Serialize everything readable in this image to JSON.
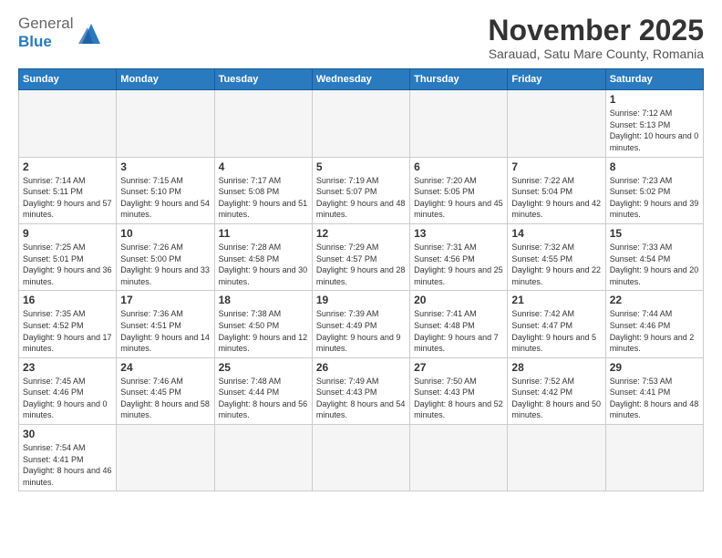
{
  "logo": {
    "text_general": "General",
    "text_blue": "Blue"
  },
  "title": "November 2025",
  "subtitle": "Sarauad, Satu Mare County, Romania",
  "headers": [
    "Sunday",
    "Monday",
    "Tuesday",
    "Wednesday",
    "Thursday",
    "Friday",
    "Saturday"
  ],
  "weeks": [
    [
      {
        "day": "",
        "empty": true
      },
      {
        "day": "",
        "empty": true
      },
      {
        "day": "",
        "empty": true
      },
      {
        "day": "",
        "empty": true
      },
      {
        "day": "",
        "empty": true
      },
      {
        "day": "",
        "empty": true
      },
      {
        "day": "1",
        "sunrise": "7:12 AM",
        "sunset": "5:13 PM",
        "daylight": "10 hours and 0 minutes."
      }
    ],
    [
      {
        "day": "2",
        "sunrise": "7:14 AM",
        "sunset": "5:11 PM",
        "daylight": "9 hours and 57 minutes."
      },
      {
        "day": "3",
        "sunrise": "7:15 AM",
        "sunset": "5:10 PM",
        "daylight": "9 hours and 54 minutes."
      },
      {
        "day": "4",
        "sunrise": "7:17 AM",
        "sunset": "5:08 PM",
        "daylight": "9 hours and 51 minutes."
      },
      {
        "day": "5",
        "sunrise": "7:19 AM",
        "sunset": "5:07 PM",
        "daylight": "9 hours and 48 minutes."
      },
      {
        "day": "6",
        "sunrise": "7:20 AM",
        "sunset": "5:05 PM",
        "daylight": "9 hours and 45 minutes."
      },
      {
        "day": "7",
        "sunrise": "7:22 AM",
        "sunset": "5:04 PM",
        "daylight": "9 hours and 42 minutes."
      },
      {
        "day": "8",
        "sunrise": "7:23 AM",
        "sunset": "5:02 PM",
        "daylight": "9 hours and 39 minutes."
      }
    ],
    [
      {
        "day": "9",
        "sunrise": "7:25 AM",
        "sunset": "5:01 PM",
        "daylight": "9 hours and 36 minutes."
      },
      {
        "day": "10",
        "sunrise": "7:26 AM",
        "sunset": "5:00 PM",
        "daylight": "9 hours and 33 minutes."
      },
      {
        "day": "11",
        "sunrise": "7:28 AM",
        "sunset": "4:58 PM",
        "daylight": "9 hours and 30 minutes."
      },
      {
        "day": "12",
        "sunrise": "7:29 AM",
        "sunset": "4:57 PM",
        "daylight": "9 hours and 28 minutes."
      },
      {
        "day": "13",
        "sunrise": "7:31 AM",
        "sunset": "4:56 PM",
        "daylight": "9 hours and 25 minutes."
      },
      {
        "day": "14",
        "sunrise": "7:32 AM",
        "sunset": "4:55 PM",
        "daylight": "9 hours and 22 minutes."
      },
      {
        "day": "15",
        "sunrise": "7:33 AM",
        "sunset": "4:54 PM",
        "daylight": "9 hours and 20 minutes."
      }
    ],
    [
      {
        "day": "16",
        "sunrise": "7:35 AM",
        "sunset": "4:52 PM",
        "daylight": "9 hours and 17 minutes."
      },
      {
        "day": "17",
        "sunrise": "7:36 AM",
        "sunset": "4:51 PM",
        "daylight": "9 hours and 14 minutes."
      },
      {
        "day": "18",
        "sunrise": "7:38 AM",
        "sunset": "4:50 PM",
        "daylight": "9 hours and 12 minutes."
      },
      {
        "day": "19",
        "sunrise": "7:39 AM",
        "sunset": "4:49 PM",
        "daylight": "9 hours and 9 minutes."
      },
      {
        "day": "20",
        "sunrise": "7:41 AM",
        "sunset": "4:48 PM",
        "daylight": "9 hours and 7 minutes."
      },
      {
        "day": "21",
        "sunrise": "7:42 AM",
        "sunset": "4:47 PM",
        "daylight": "9 hours and 5 minutes."
      },
      {
        "day": "22",
        "sunrise": "7:44 AM",
        "sunset": "4:46 PM",
        "daylight": "9 hours and 2 minutes."
      }
    ],
    [
      {
        "day": "23",
        "sunrise": "7:45 AM",
        "sunset": "4:46 PM",
        "daylight": "9 hours and 0 minutes."
      },
      {
        "day": "24",
        "sunrise": "7:46 AM",
        "sunset": "4:45 PM",
        "daylight": "8 hours and 58 minutes."
      },
      {
        "day": "25",
        "sunrise": "7:48 AM",
        "sunset": "4:44 PM",
        "daylight": "8 hours and 56 minutes."
      },
      {
        "day": "26",
        "sunrise": "7:49 AM",
        "sunset": "4:43 PM",
        "daylight": "8 hours and 54 minutes."
      },
      {
        "day": "27",
        "sunrise": "7:50 AM",
        "sunset": "4:43 PM",
        "daylight": "8 hours and 52 minutes."
      },
      {
        "day": "28",
        "sunrise": "7:52 AM",
        "sunset": "4:42 PM",
        "daylight": "8 hours and 50 minutes."
      },
      {
        "day": "29",
        "sunrise": "7:53 AM",
        "sunset": "4:41 PM",
        "daylight": "8 hours and 48 minutes."
      }
    ],
    [
      {
        "day": "30",
        "sunrise": "7:54 AM",
        "sunset": "4:41 PM",
        "daylight": "8 hours and 46 minutes."
      },
      {
        "day": "",
        "empty": true
      },
      {
        "day": "",
        "empty": true
      },
      {
        "day": "",
        "empty": true
      },
      {
        "day": "",
        "empty": true
      },
      {
        "day": "",
        "empty": true
      },
      {
        "day": "",
        "empty": true
      }
    ]
  ]
}
